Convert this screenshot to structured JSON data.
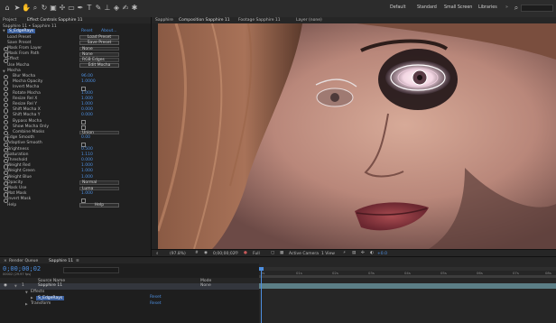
{
  "colors": {
    "accent": "#5a9de6",
    "value_blue": "#4d8fe0",
    "layer_bar": "#5b7e86"
  },
  "toolbar": {
    "icons": [
      "home-icon",
      "selection-tool-icon",
      "hand-tool-icon",
      "zoom-tool-icon",
      "rotate-tool-icon",
      "camera-tool-icon",
      "pan-behind-tool-icon",
      "mask-tool-icon",
      "pen-tool-icon",
      "type-tool-icon",
      "brush-tool-icon",
      "clone-stamp-icon",
      "eraser-icon",
      "roto-brush-icon",
      "puppet-tool-icon"
    ],
    "workspace_options": [
      "Default",
      "Standard",
      "Small Screen",
      "Libraries"
    ],
    "search_placeholder": "Search Help"
  },
  "left_panel": {
    "tabs": [
      "Project",
      "Effect Controls Sapphire 11"
    ],
    "header_path": "Sapphire 11 • Sapphire 11",
    "reset_label": "Reset",
    "about_label": "About...",
    "effect_name": "S_EdgeRays",
    "properties": [
      {
        "label": "Load Preset",
        "kind": "button",
        "value": "Load Preset"
      },
      {
        "label": "Save Preset",
        "kind": "button",
        "value": "Save Preset"
      },
      {
        "label": "Mask From Layer",
        "kind": "dropdown",
        "value": "None"
      },
      {
        "label": "Mask From Path",
        "kind": "dropdown",
        "value": "None"
      },
      {
        "label": "Effect",
        "kind": "dropdown",
        "value": "RGB Edges"
      },
      {
        "label": "Use Mocha",
        "kind": "button",
        "value": "Edit Mocha"
      },
      {
        "label": "Mocha",
        "kind": "group",
        "value": ""
      },
      {
        "label": "Blur Mocha",
        "kind": "value",
        "value": "96.00"
      },
      {
        "label": "Mocha Opacity",
        "kind": "value",
        "value": "1.0000"
      },
      {
        "label": "Invert Mocha",
        "kind": "checkbox",
        "value": ""
      },
      {
        "label": "Rotate Mocha",
        "kind": "value",
        "value": "1.000"
      },
      {
        "label": "Resize Rel X",
        "kind": "value",
        "value": "1.000"
      },
      {
        "label": "Resize Rel Y",
        "kind": "value",
        "value": "1.000"
      },
      {
        "label": "Shift Mocha X",
        "kind": "value",
        "value": "0.000"
      },
      {
        "label": "Shift Mocha Y",
        "kind": "value",
        "value": "0.000"
      },
      {
        "label": "Bypass Mocha",
        "kind": "checkbox",
        "value": ""
      },
      {
        "label": "Show Mocha Only",
        "kind": "checkbox",
        "value": ""
      },
      {
        "label": "Combine Masks",
        "kind": "dropdown",
        "value": "Union"
      },
      {
        "label": "Edge Smooth",
        "kind": "value",
        "value": "0.00"
      },
      {
        "label": "Adaptive Smooth",
        "kind": "checkbox",
        "value": ""
      },
      {
        "label": "Brightness",
        "kind": "value",
        "value": "0.500"
      },
      {
        "label": "Saturation",
        "kind": "value",
        "value": "1.110"
      },
      {
        "label": "Threshold",
        "kind": "value",
        "value": "0.000"
      },
      {
        "label": "Weight Red",
        "kind": "value",
        "value": "1.000"
      },
      {
        "label": "Weight Green",
        "kind": "value",
        "value": "1.000"
      },
      {
        "label": "Weight Blue",
        "kind": "value",
        "value": "1.000"
      },
      {
        "label": "Opacity",
        "kind": "dropdown",
        "value": "Normal"
      },
      {
        "label": "Mask Use",
        "kind": "dropdown",
        "value": "Luma"
      },
      {
        "label": "Mat Mask",
        "kind": "value",
        "value": "1.000"
      },
      {
        "label": "Invert Mask",
        "kind": "checkbox",
        "value": ""
      },
      {
        "label": "Help",
        "kind": "button",
        "value": "Help"
      }
    ]
  },
  "comp_panel": {
    "tabs": [
      "Sapphire",
      "Composition Sapphire 11",
      "Footage Sapphire 11",
      "Layer (none)"
    ],
    "sub_tab": "Sapphire 11",
    "viewer_controls": {
      "zoom": "(97.8%)",
      "timecode": "0;00;00;02",
      "resolution": "Full",
      "camera": "Active Camera",
      "views": "1 View",
      "exposure": "+0.0"
    }
  },
  "timeline": {
    "tabs": [
      "Render Queue",
      "Sapphire 11"
    ],
    "timecode": "0;00;00;02",
    "frame_info": "00002 (29.97 fps)",
    "column_headers": {
      "source": "Source Name",
      "mode": "Mode"
    },
    "layers": [
      {
        "num": "1",
        "name": "Sapphire 11",
        "mode": "None"
      },
      {
        "name": "Effects"
      },
      {
        "name": "S_EdgeRays",
        "value": "Reset"
      },
      {
        "name": "Transform",
        "value": "Reset"
      }
    ],
    "ruler_ticks": [
      "0s",
      "01s",
      "02s",
      "03s",
      "04s",
      "05s",
      "06s",
      "07s",
      "08s"
    ]
  }
}
